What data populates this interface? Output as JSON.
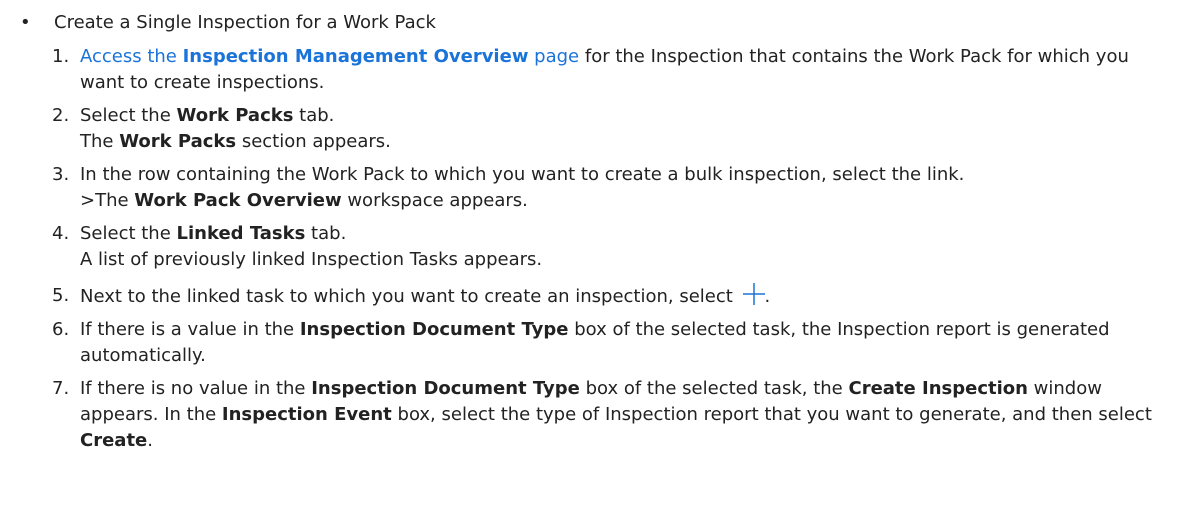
{
  "bullet": {
    "symbol": "•",
    "title": "Create a Single Inspection for a Work Pack"
  },
  "steps": [
    {
      "num": "1.",
      "link_text_a": "Access the ",
      "link_text_b": "Inspection Management Overview",
      "link_text_c": " page",
      "text": " for the Inspection that contains the Work Pack for which you want to create inspections."
    },
    {
      "num": "2.",
      "a": "Select the ",
      "b": "Work Packs",
      "c": " tab.",
      "d": "The ",
      "e": "Work Packs",
      "f": " section appears."
    },
    {
      "num": "3.",
      "a": "In the row containing the Work Pack to which you want to create a bulk inspection, select the link.",
      "b": ">The ",
      "c": "Work Pack Overview",
      "d": " workspace appears."
    },
    {
      "num": "4.",
      "a": "Select the ",
      "b": "Linked Tasks",
      "c": " tab.",
      "d": "A list of previously linked Inspection Tasks appears."
    },
    {
      "num": "5.",
      "a": "Next to the linked task to which you want to create an inspection, select ",
      "icon": "plus-icon",
      "b": "."
    },
    {
      "num": "6.",
      "a": "If there is a value in the ",
      "b": "Inspection Document Type",
      "c": " box of the selected task, the Inspection report is generated automatically."
    },
    {
      "num": "7.",
      "a": "If there is no value in the ",
      "b": "Inspection Document Type",
      "c": " box of the selected task, the ",
      "d": "Create Inspection",
      "e": " window appears. In the ",
      "f": "Inspection Event",
      "g": " box, select the type of Inspection report that you want to generate, and then select ",
      "h": "Create",
      "i": "."
    }
  ],
  "colors": {
    "link": "#1a73d9",
    "text": "#222222",
    "icon": "#1a73d9"
  }
}
